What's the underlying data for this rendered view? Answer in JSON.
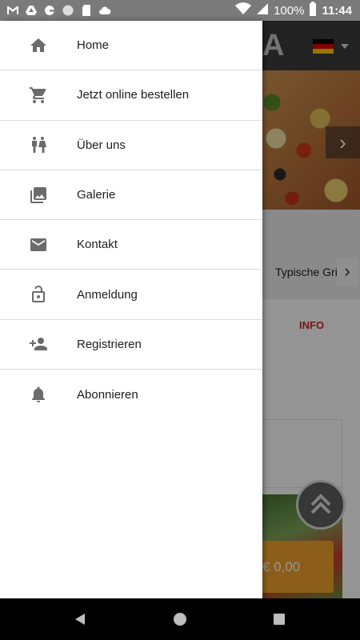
{
  "status_bar": {
    "battery": "100%",
    "time": "11:44",
    "icons": [
      "gmail-icon",
      "drive-icon",
      "google-icon",
      "circle-icon",
      "sd-card-icon",
      "cloud-icon",
      "wifi-icon",
      "signal-icon",
      "battery-icon"
    ]
  },
  "background_app": {
    "header_logo_partial": "A",
    "language_flag": "de",
    "category_tab_label": "Typische Gri",
    "info_tab_label": "INFO",
    "cart_total": "€ 0,00",
    "colors": {
      "header": "#3b3b3b",
      "cart_button": "#f2a32b",
      "info_tab": "#c62828"
    }
  },
  "drawer": {
    "items": [
      {
        "label": "Home",
        "icon": "home-icon"
      },
      {
        "label": "Jetzt online bestellen",
        "icon": "cart-icon"
      },
      {
        "label": "Über uns",
        "icon": "people-icon"
      },
      {
        "label": "Galerie",
        "icon": "gallery-icon"
      },
      {
        "label": "Kontakt",
        "icon": "mail-icon"
      },
      {
        "label": "Anmeldung",
        "icon": "lock-icon"
      },
      {
        "label": "Registrieren",
        "icon": "person-add-icon"
      },
      {
        "label": "Abonnieren",
        "icon": "bell-icon"
      }
    ]
  },
  "nav_bar": {
    "buttons": [
      "back-icon",
      "home-circle-icon",
      "recents-icon"
    ]
  }
}
